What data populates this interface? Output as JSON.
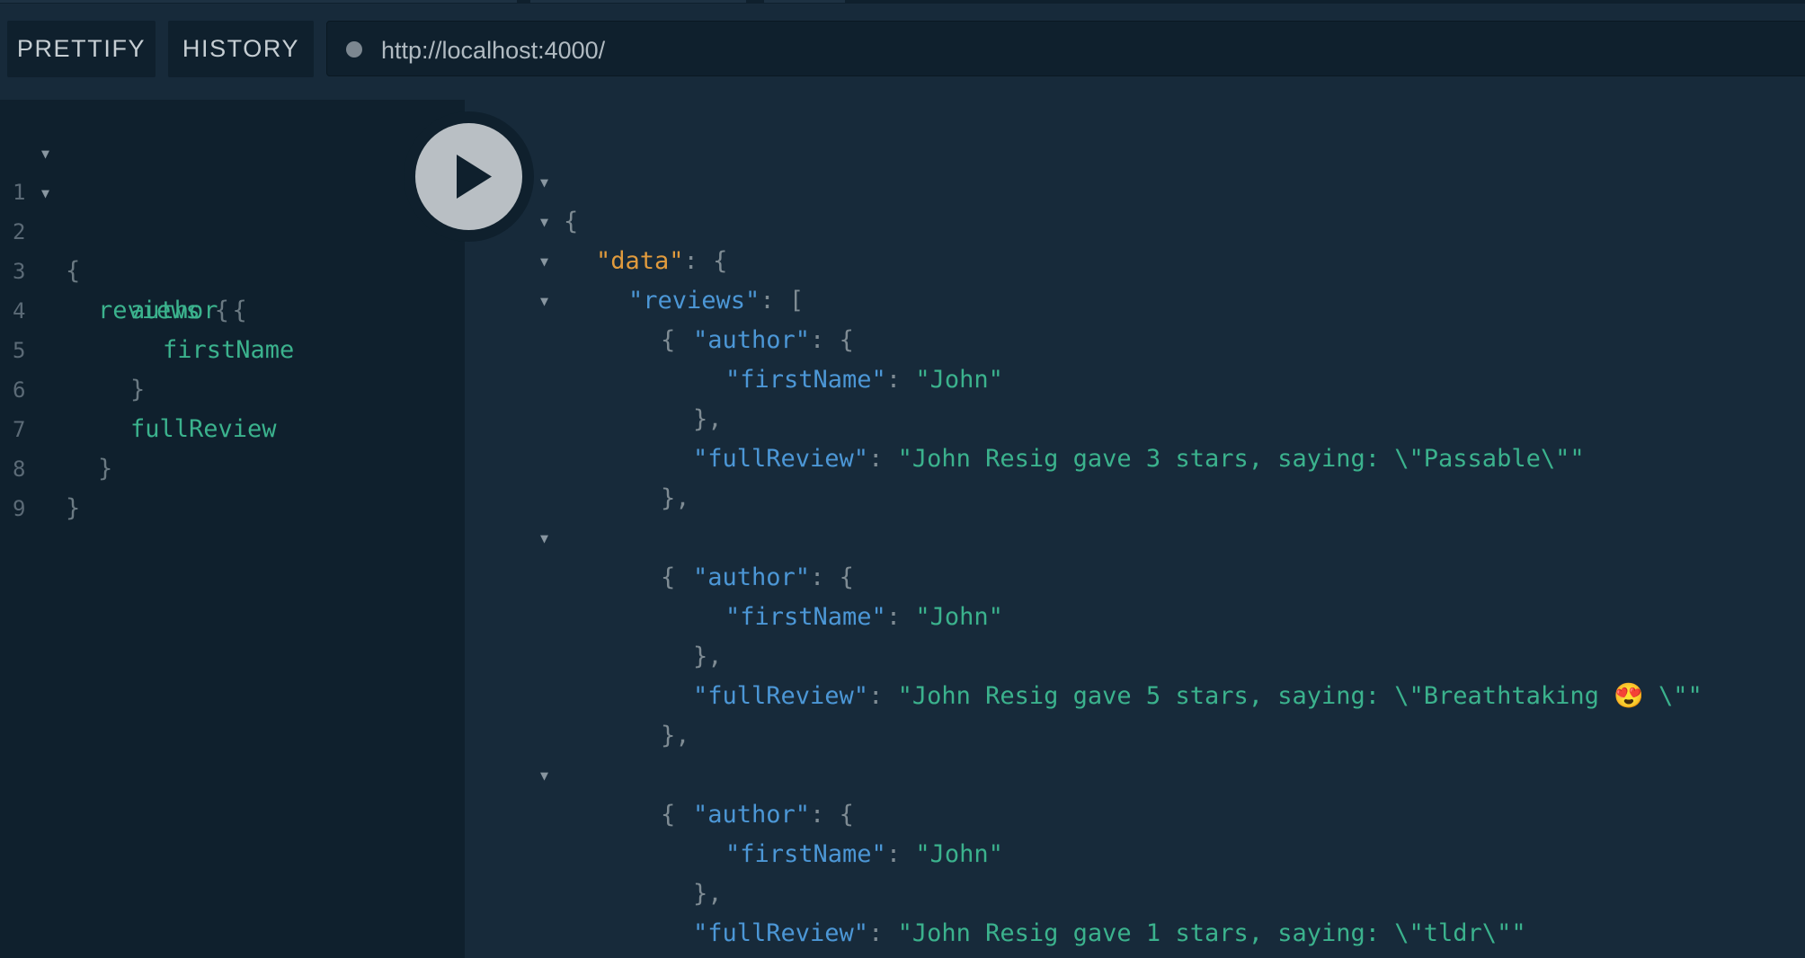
{
  "toolbar": {
    "prettify_label": "PRETTIFY",
    "history_label": "HISTORY",
    "url_value": "http://localhost:4000/"
  },
  "editor": {
    "lines": [
      {
        "num": "1",
        "text": "{"
      },
      {
        "num": "2",
        "text": "reviews"
      },
      {
        "num": "3",
        "text": "author"
      },
      {
        "num": "4",
        "text": "firstName"
      },
      {
        "num": "5",
        "text": "}"
      },
      {
        "num": "6",
        "text": "fullReview"
      },
      {
        "num": "7",
        "text": "}"
      },
      {
        "num": "8",
        "text": "}"
      },
      {
        "num": "9",
        "text": ""
      }
    ],
    "brace_open": "{"
  },
  "results": {
    "open_brace": "{",
    "data_key": "\"data\"",
    "reviews_key": "\"reviews\"",
    "author_key": "\"author\"",
    "first_name_key": "\"firstName\"",
    "full_review_key": "\"fullReview\"",
    "reviews": [
      {
        "first_name": "\"John\"",
        "full_review": "\"John Resig gave 3 stars, saying: \\\"Passable\\\"\""
      },
      {
        "first_name": "\"John\"",
        "full_review": "\"John Resig gave 5 stars, saying: \\\"Breathtaking 😍 \\\"\""
      },
      {
        "first_name": "\"John\"",
        "full_review": "\"John Resig gave 1 stars, saying: \\\"tldr\\\"\""
      }
    ]
  },
  "icons": {
    "fold": "fold-arrow-icon",
    "play": "play-icon",
    "status": "status-dot-icon"
  }
}
